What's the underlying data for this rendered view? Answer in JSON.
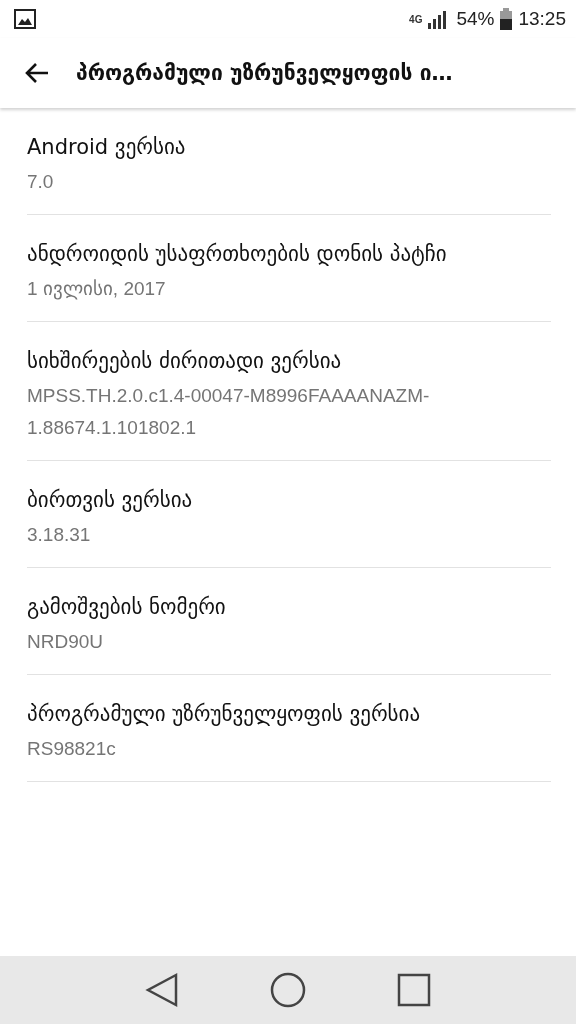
{
  "status_bar": {
    "network": "4G",
    "battery": "54%",
    "time": "13:25"
  },
  "toolbar": {
    "title": "პროგრამული უზრუნველყოფის ი…"
  },
  "items": [
    {
      "title": "Android ვერსია",
      "summary": "7.0"
    },
    {
      "title": "ანდროიდის უსაფრთხოების დონის პატჩი",
      "summary": "1 ივლისი, 2017"
    },
    {
      "title": "სიხშირეების ძირითადი ვერსია",
      "summary": "MPSS.TH.2.0.c1.4-00047-M8996FAAAANAZM-1.88674.1.101802.1"
    },
    {
      "title": "ბირთვის ვერსია",
      "summary": "3.18.31"
    },
    {
      "title": "გამოშვების ნომერი",
      "summary": "NRD90U"
    },
    {
      "title": "პროგრამული უზრუნველყოფის ვერსია",
      "summary": "RS98821c"
    }
  ]
}
